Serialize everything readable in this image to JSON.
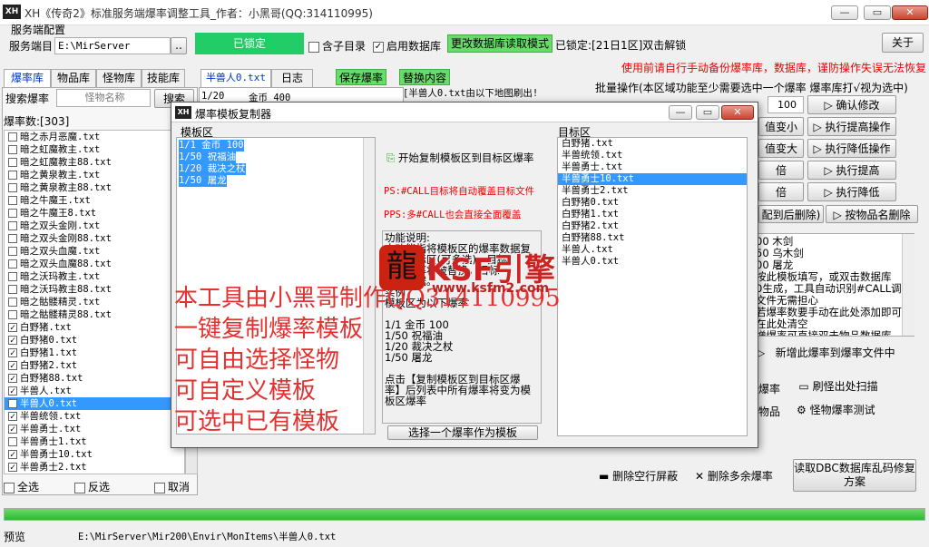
{
  "window": {
    "title": "XH《传奇2》标准服务端爆率调整工具_作者：小黑哥(QQ:314110995)",
    "app_icon": "XH",
    "controls": [
      "—",
      "▭",
      "✕"
    ]
  },
  "server": {
    "group_label": "服务端配置",
    "path_label": "服务端目",
    "path_value": "E:\\MirServer",
    "browse_label": "..",
    "locked_label": "已锁定",
    "subdir_label": "含子目录",
    "use_db_label": "启用数据库",
    "change_db_mode": "更改数据库读取模式",
    "locked_info": "已锁定:[21日1区]双击解锁",
    "about_label": "关于"
  },
  "warning": "使用前请自行手动备份爆率库，数据库，谨防操作失误无法恢复",
  "left_tabs": [
    "爆率库",
    "物品库",
    "怪物库",
    "技能库"
  ],
  "left_search": {
    "label": "搜索爆率",
    "placeholder": "怪物名称",
    "button": "搜索"
  },
  "rate_count": "爆率数:[303]",
  "rate_list": [
    {
      "name": "暗之赤月恶魔.txt",
      "checked": false
    },
    {
      "name": "暗之虹魔教主.txt",
      "checked": false
    },
    {
      "name": "暗之虹魔教主88.txt",
      "checked": false
    },
    {
      "name": "暗之黄泉教主.txt",
      "checked": false
    },
    {
      "name": "暗之黄泉教主88.txt",
      "checked": false
    },
    {
      "name": "暗之牛魔王.txt",
      "checked": false
    },
    {
      "name": "暗之牛魔王8.txt",
      "checked": false
    },
    {
      "name": "暗之双头金刚.txt",
      "checked": false
    },
    {
      "name": "暗之双头金刚88.txt",
      "checked": false
    },
    {
      "name": "暗之双头血魔.txt",
      "checked": false
    },
    {
      "name": "暗之双头血魔88.txt",
      "checked": false
    },
    {
      "name": "暗之沃玛教主.txt",
      "checked": false
    },
    {
      "name": "暗之沃玛教主88.txt",
      "checked": false
    },
    {
      "name": "暗之骷髅精灵.txt",
      "checked": false
    },
    {
      "name": "暗之骷髅精灵88.txt",
      "checked": false
    },
    {
      "name": "白野猪.txt",
      "checked": true
    },
    {
      "name": "白野猪0.txt",
      "checked": true
    },
    {
      "name": "白野猪1.txt",
      "checked": true
    },
    {
      "name": "白野猪2.txt",
      "checked": true
    },
    {
      "name": "白野猪88.txt",
      "checked": true
    },
    {
      "name": "半兽人.txt",
      "checked": true
    },
    {
      "name": "半兽人0.txt",
      "checked": true,
      "selected": true
    },
    {
      "name": "半兽统领.txt",
      "checked": true
    },
    {
      "name": "半兽勇士.txt",
      "checked": true
    },
    {
      "name": "半兽勇士1.txt",
      "checked": false
    },
    {
      "name": "半兽勇士10.txt",
      "checked": true
    },
    {
      "name": "半兽勇士2.txt",
      "checked": true
    }
  ],
  "list_footer": {
    "all": "全选",
    "invert": "反选",
    "cancel": "取消"
  },
  "middle": {
    "file_tab": "半兽人0.txt",
    "log_tab": "日志",
    "save_label": "保存爆率",
    "replace_label": "替换内容",
    "refresh_note": "[半兽人0.txt由以下地图刷出!",
    "row": [
      "1/20",
      "金币 400"
    ]
  },
  "batch": {
    "title": "批量操作(本区域功能至少需要选中一个爆率 爆率库打√视为选中)",
    "value": "100",
    "confirm": "确认修改",
    "rows": [
      "值变小",
      "执行提高操作",
      "值变大",
      "执行降低操作",
      "倍",
      "执行提高",
      "倍",
      "执行降低"
    ],
    "delete_after": "配到后删除)",
    "delete_by_name": "按物品名删除",
    "template_lines": [
      "00 木剑",
      "50 乌木剑",
      "00 屠龙"
    ],
    "desc_lines": [
      "按此模板填写，或双击数据库",
      "0生成，工具自动识别#CALL调",
      "文件无需担心",
      "若爆率数要手动在此处添加即可",
      "在此处清空",
      "增爆率可直接双击物品数据库"
    ],
    "add_new": "新增此爆率到爆率文件中",
    "rate_btn": "爆率",
    "scan_btn": "刷怪出处扫描",
    "item_btn": "物品",
    "test_btn": "怪物爆率测试",
    "del_blank": "删除空行屏蔽",
    "del_extra": "删除多余爆率",
    "dbc_fix": "读取DBC数据库乱码修复方案"
  },
  "status": {
    "label": "预览",
    "path": "E:\\MirServer\\Mir200\\Envir\\MonItems\\半兽人0.txt"
  },
  "dialog": {
    "title": "爆率模板复制器",
    "template_label": "模板区",
    "template_lines": [
      "1/1 金币 100",
      "1/50 祝福油",
      "1/20 裁决之杖",
      "1/50 屠龙"
    ],
    "copy_button": "开始复制模板区到目标区爆率",
    "ps1": "PS:#CALL目标将自动覆盖目标文件",
    "ps2": "PPS:多#CALL也会直接全面覆盖",
    "desc_lines": [
      "功能说明:",
      "本功能指将模板区的爆率数据复",
      "制到目标区(可多选)，目标",
      "区原爆率将被替换，目标",
      "爆率数据。",
      "实例",
      "模板区为以下爆率",
      "",
      "1/1 金币 100",
      "1/50 祝福油",
      "1/20 裁决之杖",
      "1/50 屠龙",
      "",
      "点击【复制模板区到目标区爆",
      "率】后列表中所有爆率将变为模",
      "板区爆率"
    ],
    "choose_button": "选择一个爆率作为模板",
    "target_label": "目标区",
    "target_list": [
      {
        "name": "白野猪.txt",
        "selected": false
      },
      {
        "name": "半兽统领.txt",
        "selected": false
      },
      {
        "name": "半兽勇士.txt",
        "selected": false
      },
      {
        "name": "半兽勇士10.txt",
        "selected": true
      },
      {
        "name": "半兽勇士2.txt",
        "selected": false
      },
      {
        "name": "白野猪0.txt",
        "selected": false
      },
      {
        "name": "白野猪1.txt",
        "selected": false
      },
      {
        "name": "白野猪2.txt",
        "selected": false
      },
      {
        "name": "白野猪88.txt",
        "selected": false
      },
      {
        "name": "半兽人.txt",
        "selected": false
      },
      {
        "name": "半兽人0.txt",
        "selected": false
      }
    ]
  },
  "overlay": {
    "lines": [
      "本工具由小黑哥制作QQ314110995",
      "一键复制爆率模板",
      "可自由选择怪物",
      "可自定义模板",
      "可选中已有模板"
    ],
    "watermark": "KSF引擎",
    "watermark_url": "www.ksfm2.com"
  },
  "colors": {
    "accent": "#3399ff",
    "green": "#66dd66",
    "warn": "#ee0000"
  }
}
